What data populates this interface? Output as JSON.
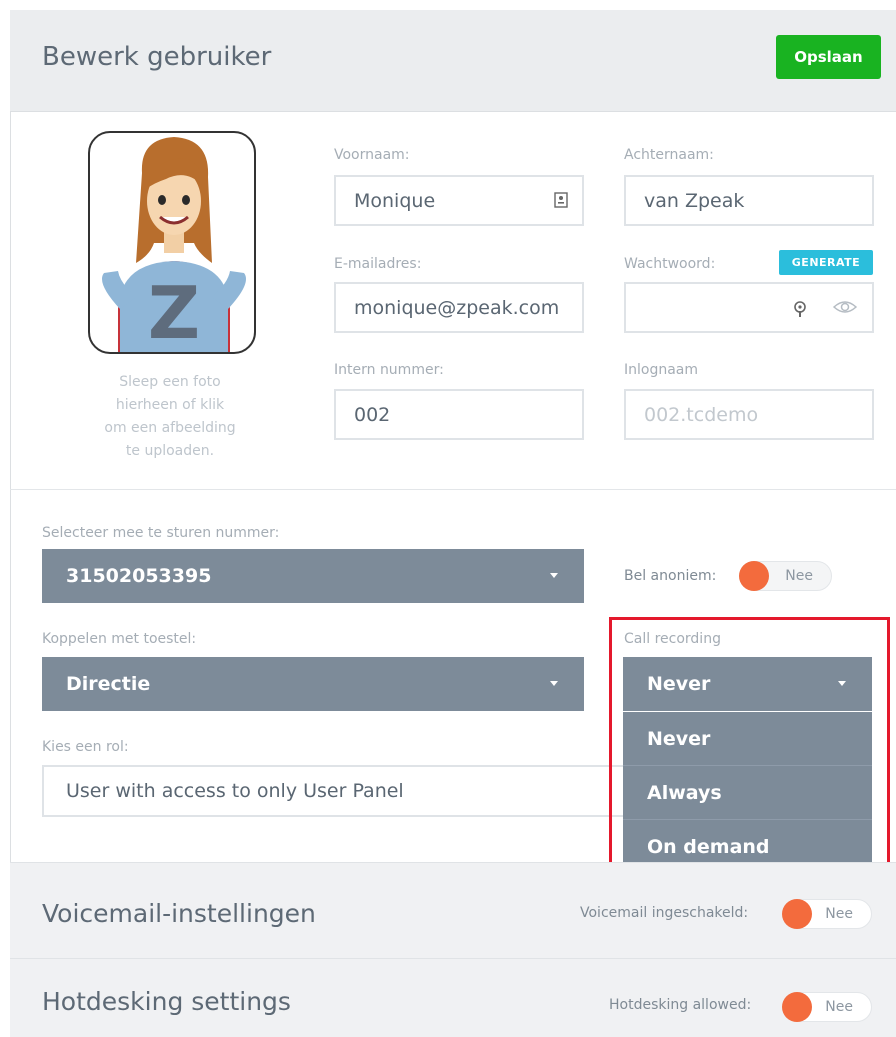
{
  "header": {
    "title": "Bewerk gebruiker",
    "save_label": "Opslaan"
  },
  "avatar": {
    "caption_lines": [
      "Sleep een foto",
      "hierheen of klik",
      "om een afbeelding",
      "te uploaden."
    ],
    "letter": "Z"
  },
  "form": {
    "first_name": {
      "label": "Voornaam:",
      "value": "Monique"
    },
    "last_name": {
      "label": "Achternaam:",
      "value": "van Zpeak"
    },
    "email": {
      "label": "E-mailadres:",
      "value": "monique@zpeak.com"
    },
    "password": {
      "label": "Wachtwoord:",
      "value": "",
      "generate_label": "GENERATE"
    },
    "internal_number": {
      "label": "Intern nummer:",
      "value": "002"
    },
    "login_name": {
      "label": "Inlognaam",
      "placeholder": "002.tcdemo"
    }
  },
  "options": {
    "caller_number": {
      "label": "Selecteer mee te sturen nummer:",
      "value": "31502053395"
    },
    "anonymous": {
      "label": "Bel anoniem:",
      "value": "Nee"
    },
    "device": {
      "label": "Koppelen met toestel:",
      "value": "Directie"
    },
    "call_recording": {
      "label": "Call recording",
      "value": "Never",
      "options": [
        "Never",
        "Always",
        "On demand"
      ]
    },
    "role": {
      "label": "Kies een rol:",
      "value": "User with access to only User Panel"
    }
  },
  "sections": {
    "voicemail": {
      "title": "Voicemail-instellingen",
      "toggle_label": "Voicemail ingeschakeld:",
      "toggle_value": "Nee"
    },
    "hotdesking": {
      "title": "Hotdesking settings",
      "toggle_label": "Hotdesking allowed:",
      "toggle_value": "Nee"
    }
  },
  "colors": {
    "accent_green": "#19b321",
    "select_gray": "#7d8b99",
    "toggle_orange": "#f36b3d",
    "highlight_red": "#e4182c",
    "generate_cyan": "#2bbedc"
  }
}
